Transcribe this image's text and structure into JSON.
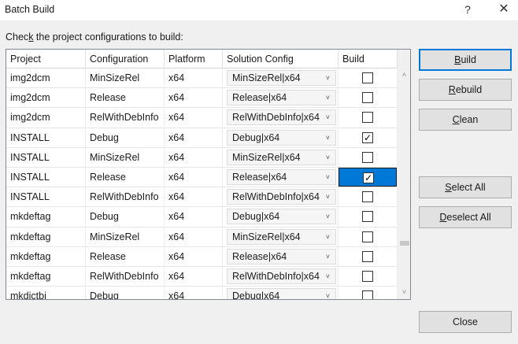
{
  "window": {
    "title": "Batch Build",
    "help_glyph": "?",
    "close_glyph": "✕"
  },
  "prompt": {
    "before": "Chec",
    "mnemonic": "k",
    "after": " the project configurations to build:"
  },
  "grid": {
    "columns": [
      "Project",
      "Configuration",
      "Platform",
      "Solution Config",
      "Build"
    ],
    "rows": [
      {
        "project": "img2dcm",
        "configuration": "MinSizeRel",
        "platform": "x64",
        "solution_config": "MinSizeRel|x64",
        "build": false,
        "selected": false
      },
      {
        "project": "img2dcm",
        "configuration": "Release",
        "platform": "x64",
        "solution_config": "Release|x64",
        "build": false,
        "selected": false
      },
      {
        "project": "img2dcm",
        "configuration": "RelWithDebInfo",
        "platform": "x64",
        "solution_config": "RelWithDebInfo|x64",
        "build": false,
        "selected": false
      },
      {
        "project": "INSTALL",
        "configuration": "Debug",
        "platform": "x64",
        "solution_config": "Debug|x64",
        "build": true,
        "selected": false
      },
      {
        "project": "INSTALL",
        "configuration": "MinSizeRel",
        "platform": "x64",
        "solution_config": "MinSizeRel|x64",
        "build": false,
        "selected": false
      },
      {
        "project": "INSTALL",
        "configuration": "Release",
        "platform": "x64",
        "solution_config": "Release|x64",
        "build": true,
        "selected": true
      },
      {
        "project": "INSTALL",
        "configuration": "RelWithDebInfo",
        "platform": "x64",
        "solution_config": "RelWithDebInfo|x64",
        "build": false,
        "selected": false
      },
      {
        "project": "mkdeftag",
        "configuration": "Debug",
        "platform": "x64",
        "solution_config": "Debug|x64",
        "build": false,
        "selected": false
      },
      {
        "project": "mkdeftag",
        "configuration": "MinSizeRel",
        "platform": "x64",
        "solution_config": "MinSizeRel|x64",
        "build": false,
        "selected": false
      },
      {
        "project": "mkdeftag",
        "configuration": "Release",
        "platform": "x64",
        "solution_config": "Release|x64",
        "build": false,
        "selected": false
      },
      {
        "project": "mkdeftag",
        "configuration": "RelWithDebInfo",
        "platform": "x64",
        "solution_config": "RelWithDebInfo|x64",
        "build": false,
        "selected": false
      },
      {
        "project": "mkdictbi",
        "configuration": "Debug",
        "platform": "x64",
        "solution_config": "Debug|x64",
        "build": false,
        "selected": false
      }
    ],
    "dropdown_glyph": "˅",
    "check_glyph": "✓",
    "scroll_up_glyph": "˄",
    "scroll_down_glyph": "˅"
  },
  "buttons": {
    "build": {
      "mnemonic": "B",
      "rest": "uild"
    },
    "rebuild": {
      "mnemonic": "R",
      "rest": "ebuild"
    },
    "clean": {
      "mnemonic": "C",
      "rest": "lean"
    },
    "select_all": {
      "mnemonic": "S",
      "rest": "elect All"
    },
    "deselect_all": {
      "mnemonic": "D",
      "rest": "eselect All"
    },
    "close": "Close"
  },
  "colors": {
    "selection": "#0078d7",
    "default_button_border": "#0078d7"
  },
  "icons": {
    "help": "question-icon",
    "close": "close-icon",
    "dropdown": "chevron-down-icon",
    "check": "checkmark-icon"
  }
}
